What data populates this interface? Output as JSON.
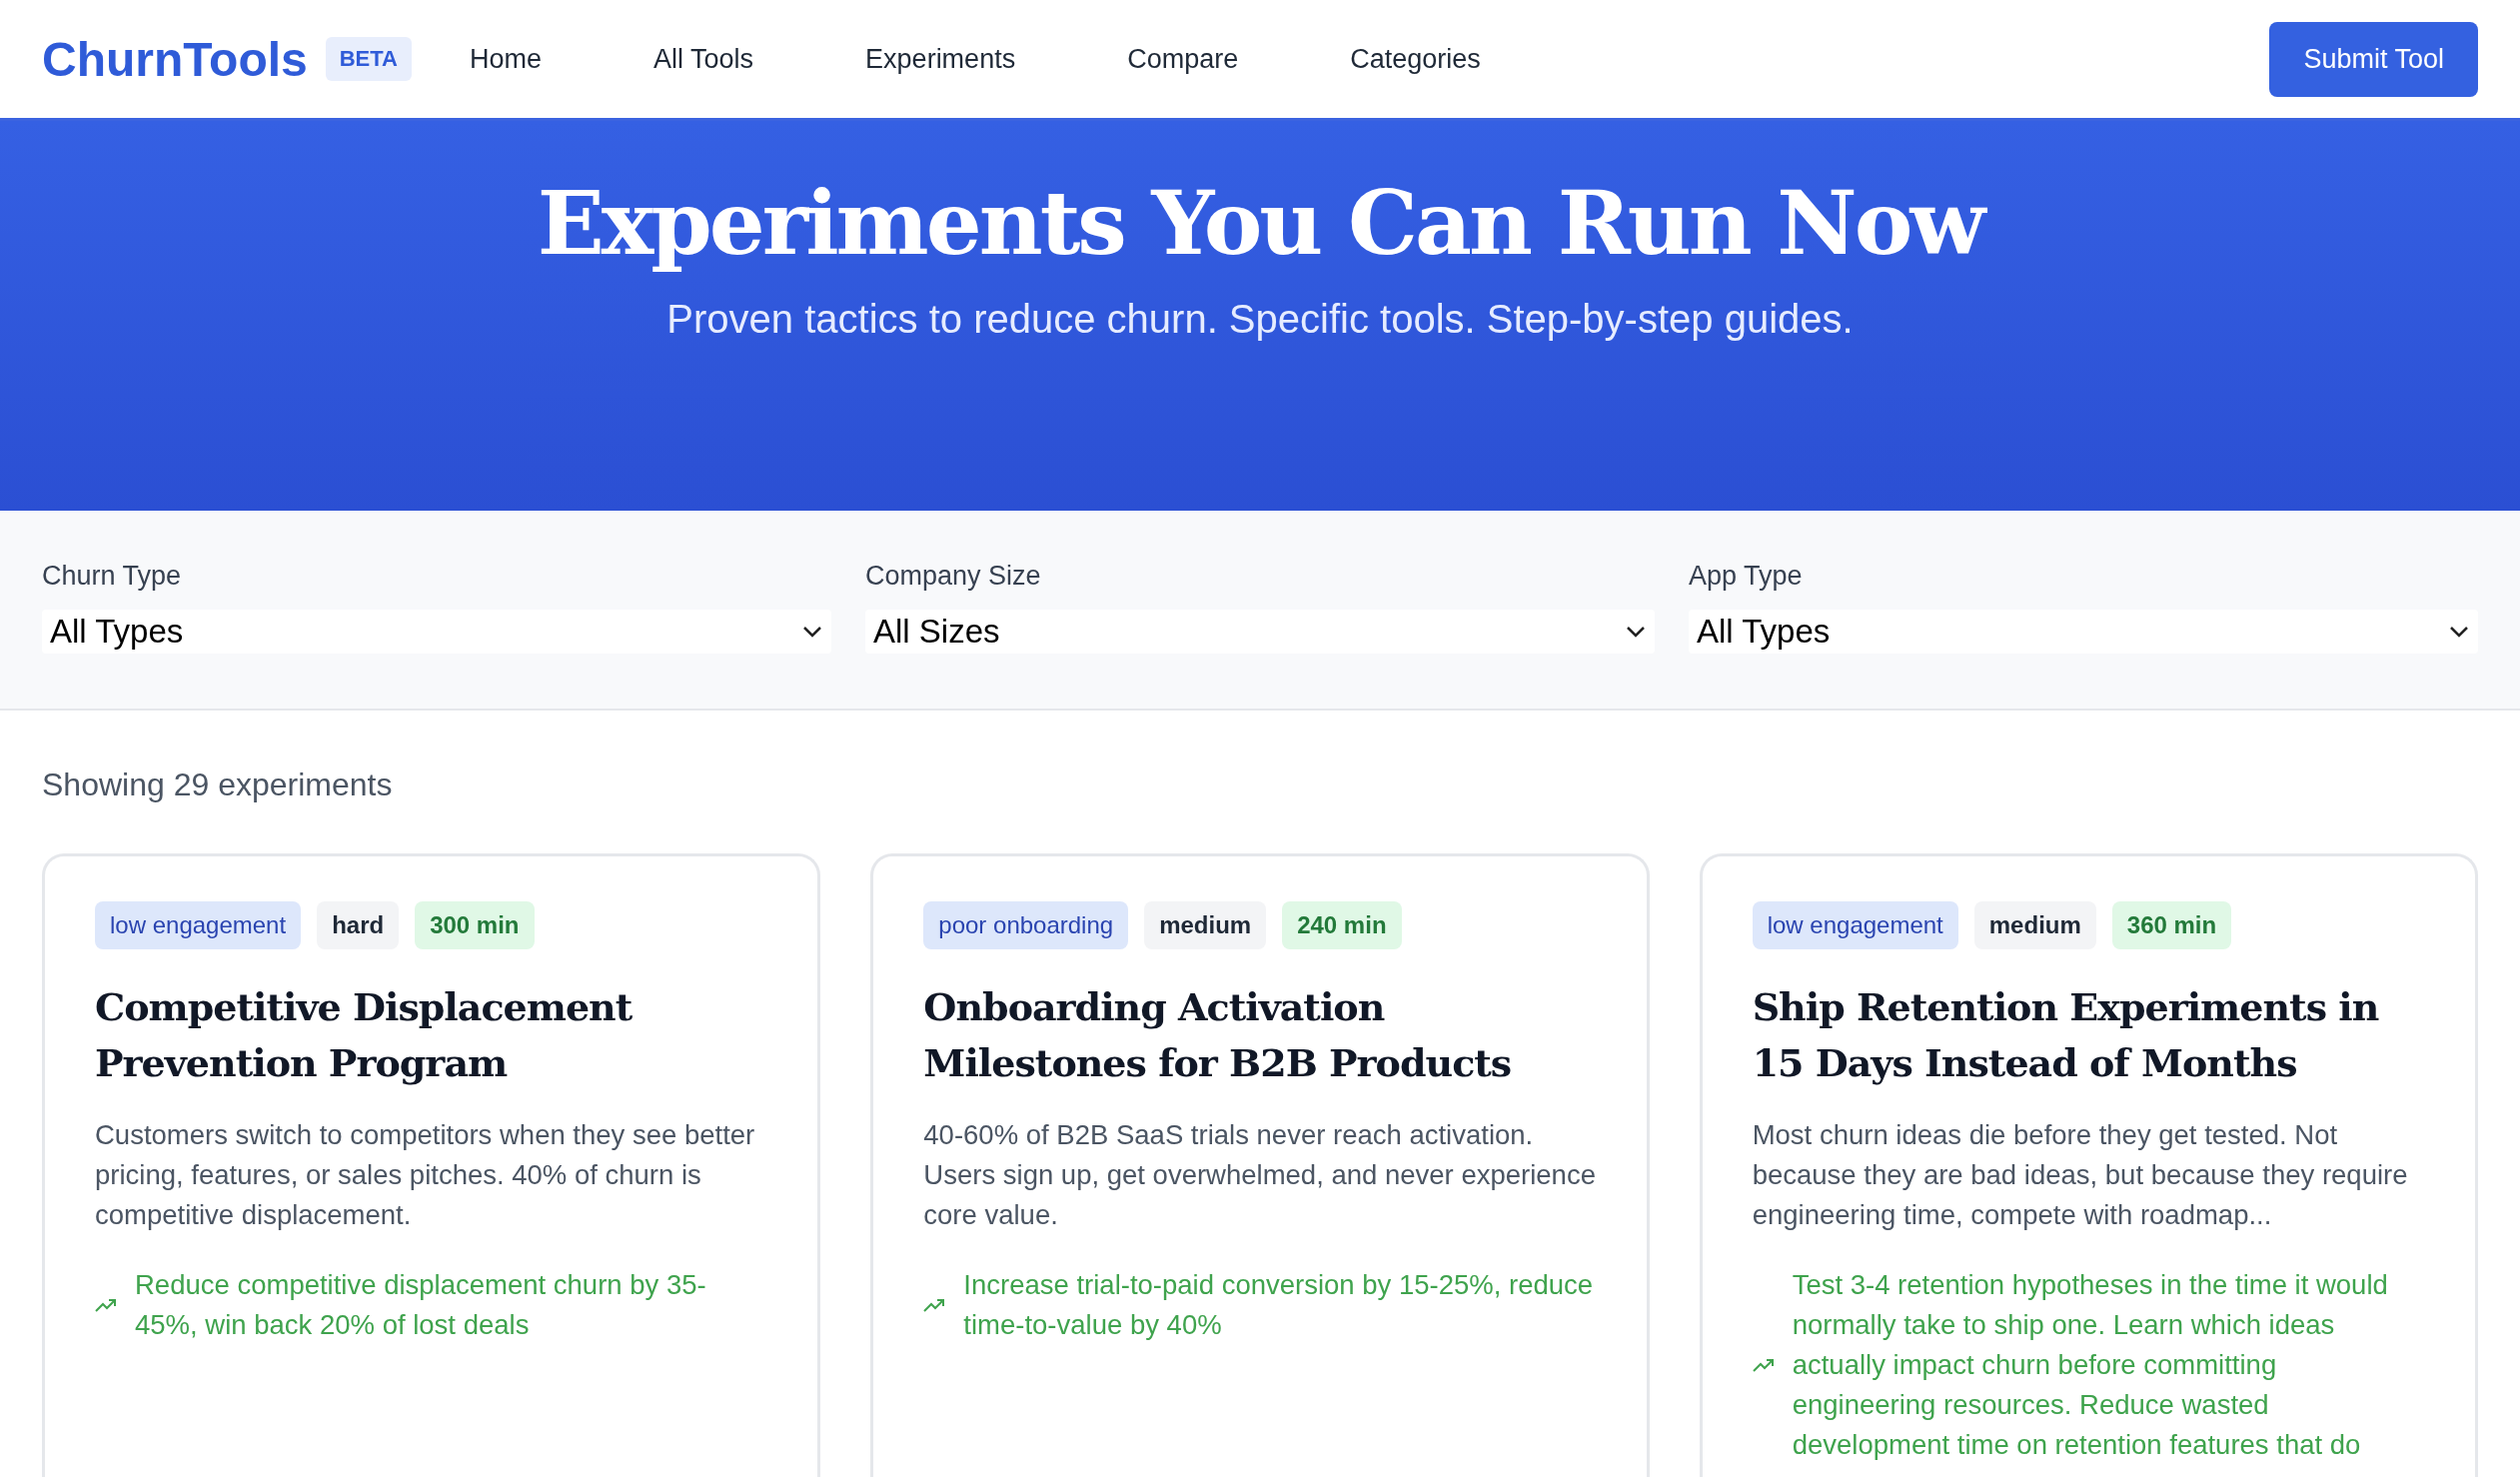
{
  "nav": {
    "logo": "ChurnTools",
    "badge": "BETA",
    "links": [
      "Home",
      "All Tools",
      "Experiments",
      "Compare",
      "Categories"
    ],
    "cta": "Submit Tool"
  },
  "hero": {
    "title": "Experiments You Can Run Now",
    "subtitle": "Proven tactics to reduce churn. Specific tools. Step-by-step guides."
  },
  "filters": [
    {
      "label": "Churn Type",
      "value": "All Types"
    },
    {
      "label": "Company Size",
      "value": "All Sizes"
    },
    {
      "label": "App Type",
      "value": "All Types"
    }
  ],
  "results_count": "Showing 29 experiments",
  "cards": [
    {
      "tags": [
        {
          "kind": "category",
          "text": "low engagement"
        },
        {
          "kind": "difficulty",
          "text": "hard"
        },
        {
          "kind": "time",
          "text": "300 min"
        }
      ],
      "title": "Competitive Displacement Prevention Program",
      "description": "Customers switch to competitors when they see better pricing, features, or sales pitches. 40% of churn is competitive displacement.",
      "outcome": "Reduce competitive displacement churn by 35-45%, win back 20% of lost deals"
    },
    {
      "tags": [
        {
          "kind": "category",
          "text": "poor onboarding"
        },
        {
          "kind": "difficulty",
          "text": "medium"
        },
        {
          "kind": "time",
          "text": "240 min"
        }
      ],
      "title": "Onboarding Activation Milestones for B2B Products",
      "description": "40-60% of B2B SaaS trials never reach activation. Users sign up, get overwhelmed, and never experience core value.",
      "outcome": "Increase trial-to-paid conversion by 15-25%, reduce time-to-value by 40%"
    },
    {
      "tags": [
        {
          "kind": "category",
          "text": "low engagement"
        },
        {
          "kind": "difficulty",
          "text": "medium"
        },
        {
          "kind": "time",
          "text": "360 min"
        }
      ],
      "title": "Ship Retention Experiments in 15 Days Instead of Months",
      "description": "Most churn ideas die before they get tested. Not because they are bad ideas, but because they require engineering time, compete with roadmap...",
      "outcome": "Test 3-4 retention hypotheses in the time it would normally take to ship one. Learn which ideas actually impact churn before committing engineering resources. Reduce wasted development time on retention features that do"
    }
  ]
}
